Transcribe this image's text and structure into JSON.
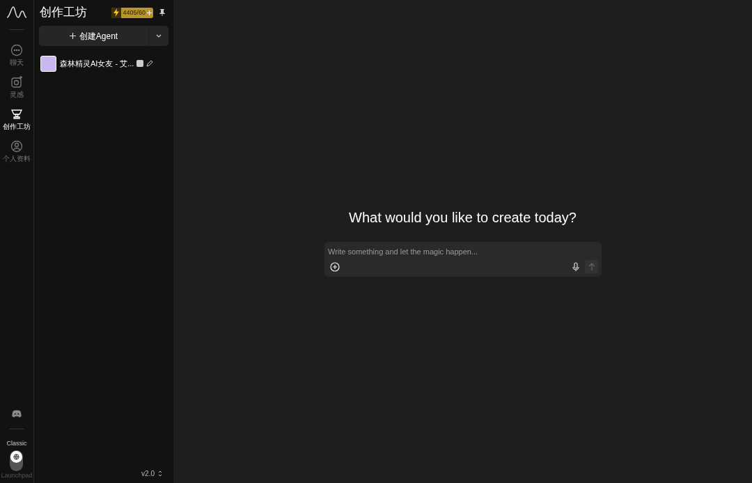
{
  "nav": {
    "items": [
      {
        "label": "聊天",
        "kind": "chat",
        "selected": false
      },
      {
        "label": "灵感",
        "kind": "inspiration",
        "selected": false
      },
      {
        "label": "创作工坊",
        "kind": "workshop",
        "selected": true
      },
      {
        "label": "个人资料",
        "kind": "profile",
        "selected": false
      }
    ],
    "mode_toggle": {
      "top_label": "Classic",
      "bottom_label": "Launchpad",
      "launchpad": false
    }
  },
  "panel": {
    "title": "创作工坊",
    "credits": "4405/60",
    "create_button": "创建Agent",
    "agents": [
      {
        "name": "森林精灵AI女友 - 艾..."
      }
    ],
    "version": "v2.0"
  },
  "main": {
    "heading": "What would you like to create today?",
    "composer": {
      "placeholder": "Write something and let the magic happen..."
    }
  }
}
